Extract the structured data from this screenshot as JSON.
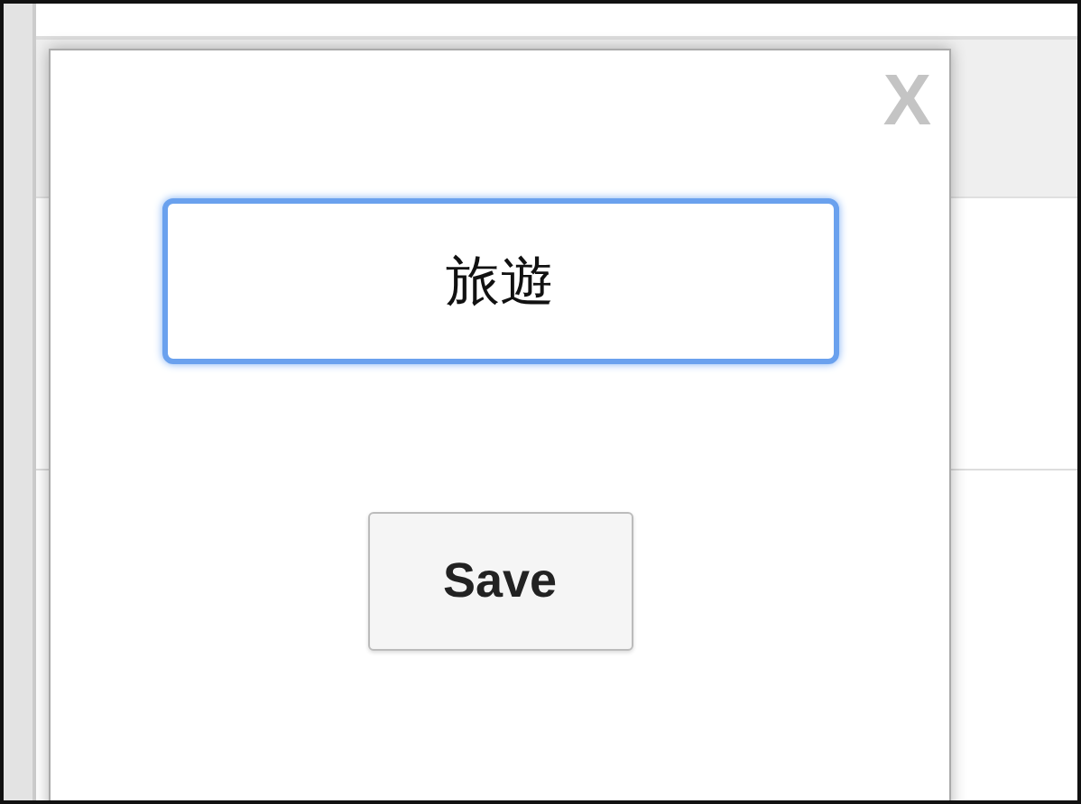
{
  "dialog": {
    "close_label": "X",
    "input": {
      "value": "旅遊",
      "focused": true
    },
    "save_button": "Save"
  }
}
